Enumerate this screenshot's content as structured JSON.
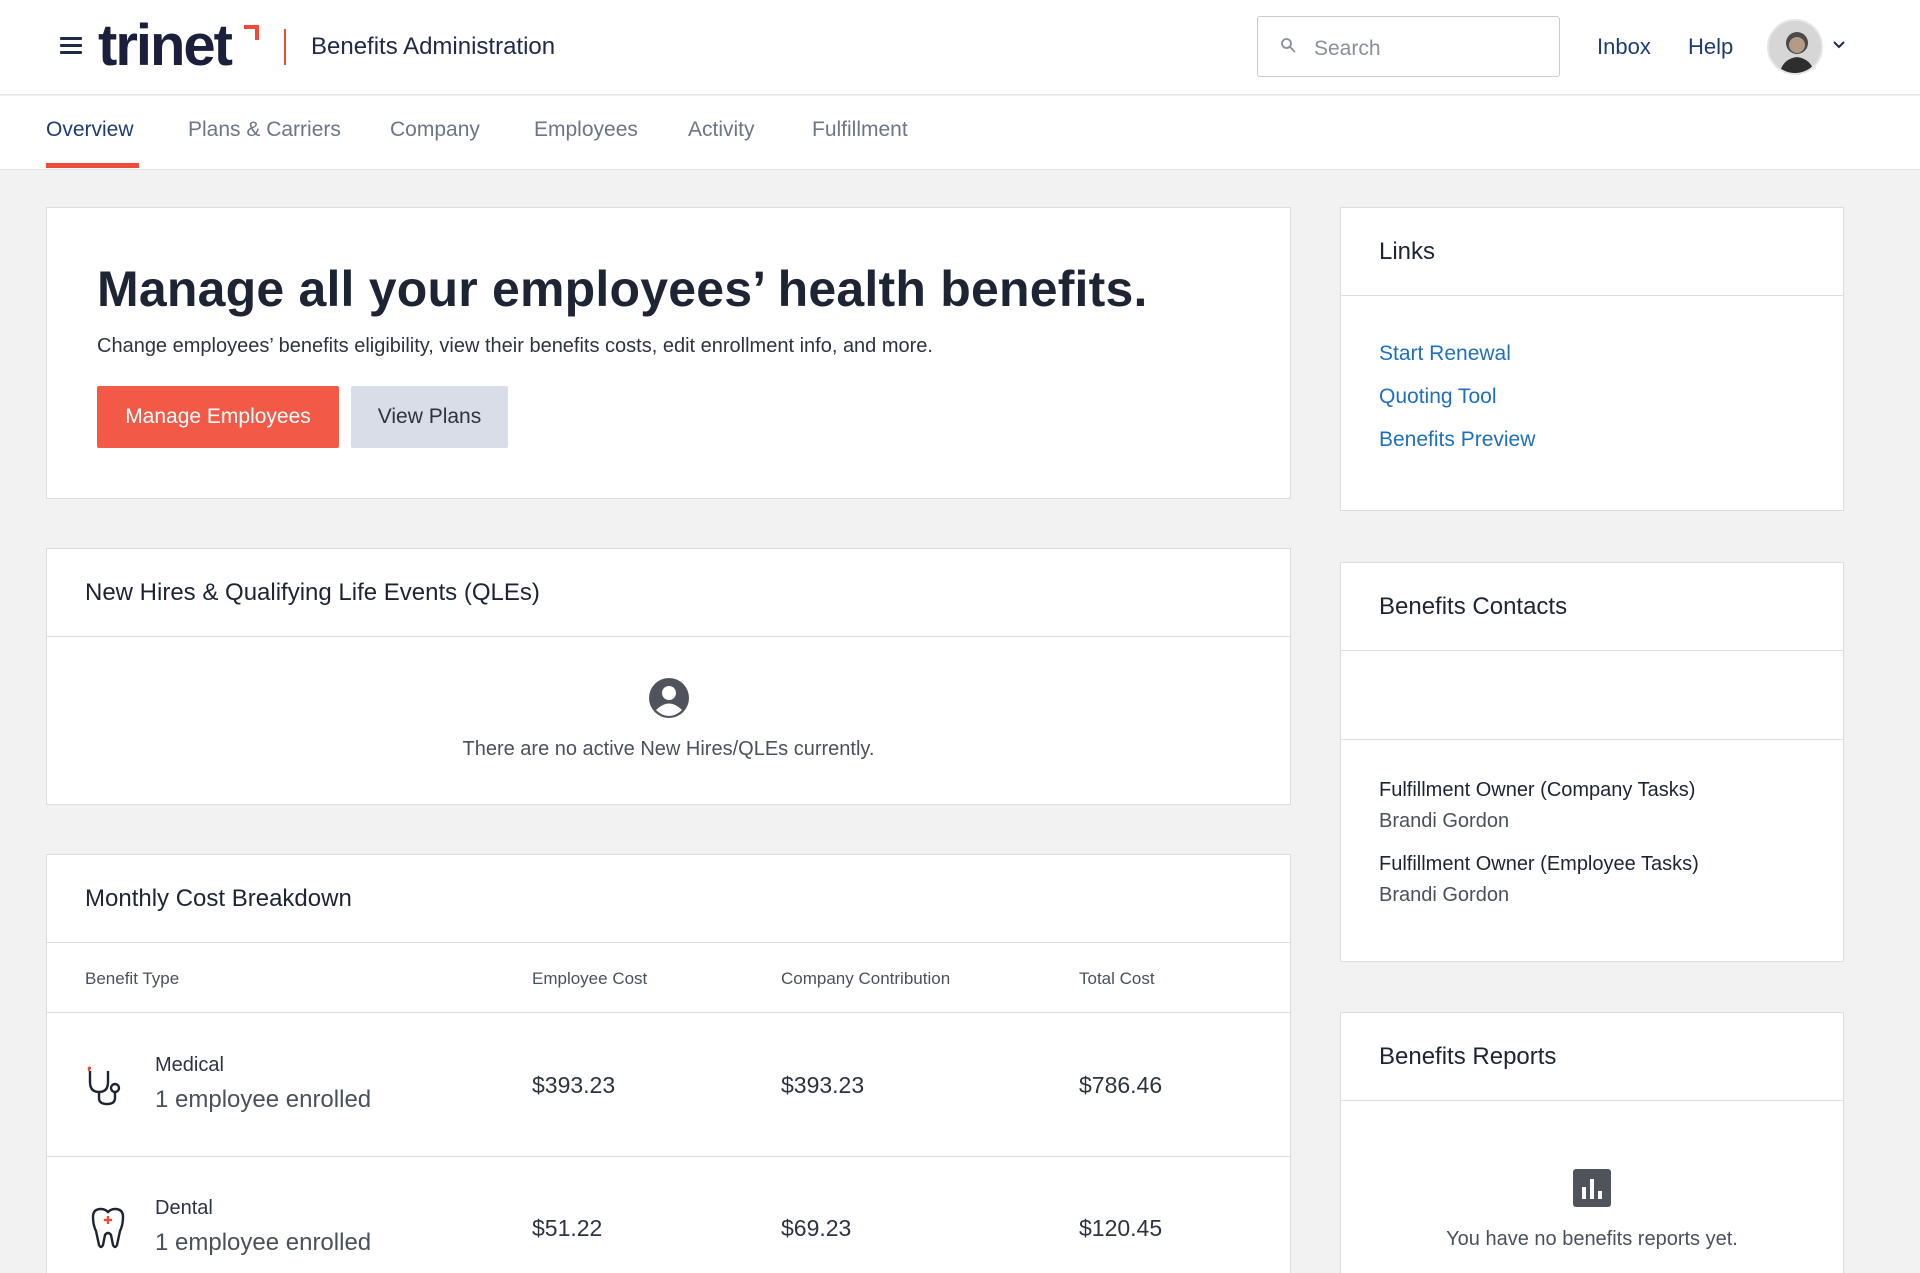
{
  "header": {
    "logo": "trinet",
    "app_title": "Benefits Administration",
    "search_placeholder": "Search",
    "inbox": "Inbox",
    "help": "Help"
  },
  "tabs": [
    {
      "label": "Overview",
      "active": true
    },
    {
      "label": "Plans & Carriers"
    },
    {
      "label": "Company"
    },
    {
      "label": "Employees"
    },
    {
      "label": "Activity"
    },
    {
      "label": "Fulfillment"
    }
  ],
  "hero": {
    "title": "Manage all your employees’ health benefits.",
    "subtitle": "Change employees’ benefits eligibility, view their benefits costs, edit enrollment info, and more.",
    "primary_button": "Manage Employees",
    "secondary_button": "View Plans"
  },
  "new_hires": {
    "title": "New Hires & Qualifying Life Events (QLEs)",
    "empty_text": "There are no active New Hires/QLEs currently.",
    "empty_icon": "user-circle-icon"
  },
  "cost_breakdown": {
    "title": "Monthly Cost Breakdown",
    "columns": [
      "Benefit Type",
      "Employee Cost",
      "Company Contribution",
      "Total Cost"
    ],
    "rows": [
      {
        "name": "Medical",
        "sub": "1 employee enrolled",
        "employee_cost": "$393.23",
        "company_contribution": "$393.23",
        "total_cost": "$786.46",
        "icon": "stethoscope-icon"
      },
      {
        "name": "Dental",
        "sub": "1 employee enrolled",
        "employee_cost": "$51.22",
        "company_contribution": "$69.23",
        "total_cost": "$120.45",
        "icon": "tooth-icon"
      }
    ]
  },
  "links": {
    "title": "Links",
    "items": [
      "Start Renewal",
      "Quoting Tool",
      "Benefits Preview"
    ]
  },
  "contacts": {
    "title": "Benefits Contacts",
    "items": [
      {
        "label": "Fulfillment Owner (Company Tasks)",
        "name": "Brandi Gordon"
      },
      {
        "label": "Fulfillment Owner (Employee Tasks)",
        "name": "Brandi Gordon"
      }
    ]
  },
  "reports": {
    "title": "Benefits Reports",
    "empty_text": "You have no benefits reports yet.",
    "empty_icon": "bar-chart-icon"
  },
  "colors": {
    "accent": "#ef4b3a",
    "primary_button": "#f25a47",
    "link": "#1f6fbf",
    "nav": "#1f3b73"
  }
}
